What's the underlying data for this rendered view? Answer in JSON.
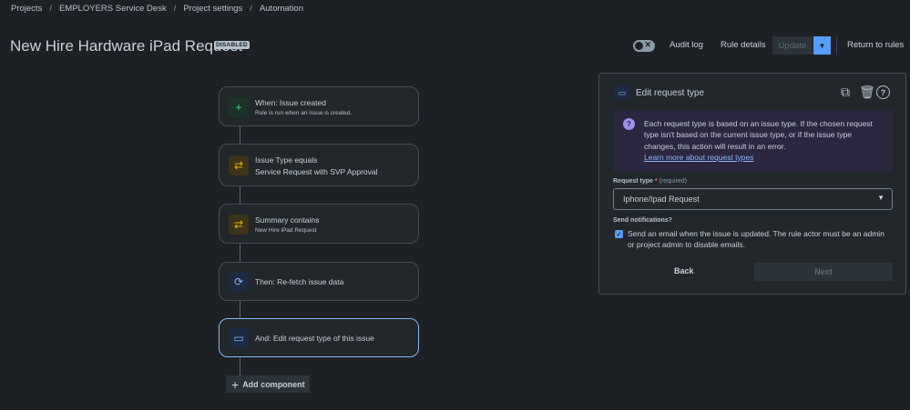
{
  "breadcrumb": [
    "Projects",
    "EMPLOYERS Service Desk",
    "Project settings",
    "Automation"
  ],
  "header": {
    "title": "New Hire Hardware iPad Request",
    "status": "DISABLED",
    "audit_log": "Audit log",
    "rule_details": "Rule details",
    "update": "Update",
    "return": "Return to rules"
  },
  "rule": {
    "nodes": [
      {
        "icon": "plus-icon",
        "title": "When: Issue created",
        "subtitle": "Rule is run when an issue is created."
      },
      {
        "icon": "shuffle-icon",
        "title": "Issue Type equals",
        "subtitle": "Service Request with SVP Approval"
      },
      {
        "icon": "shuffle-icon",
        "title": "Summary contains",
        "subtitle": "New Hire iPad Request"
      },
      {
        "icon": "refresh-icon",
        "title": "Then: Re-fetch issue data",
        "subtitle": ""
      },
      {
        "icon": "request-type-icon",
        "title": "And: Edit request type of this issue",
        "subtitle": ""
      }
    ],
    "add_component": "Add component"
  },
  "panel": {
    "title": "Edit request type",
    "info_text": "Each request type is based on an issue type. If the chosen request type isn't based on the current issue type, or if the issue type changes, this action will result in an error.",
    "info_link": "Learn more about request types",
    "request_type_label": "Request type",
    "required_mark": "*",
    "required_text": "(required)",
    "request_type_value": "Iphone/Ipad Request",
    "send_notifications_label": "Send notifications?",
    "send_notifications_checked": true,
    "send_notifications_text": "Send an email when the issue is updated. The rule actor must be an admin or project admin to disable emails.",
    "back": "Back",
    "next": "Next"
  },
  "colors": {
    "background": "#1d2125",
    "accent": "#579dff",
    "selected_border": "#85b8ff"
  }
}
